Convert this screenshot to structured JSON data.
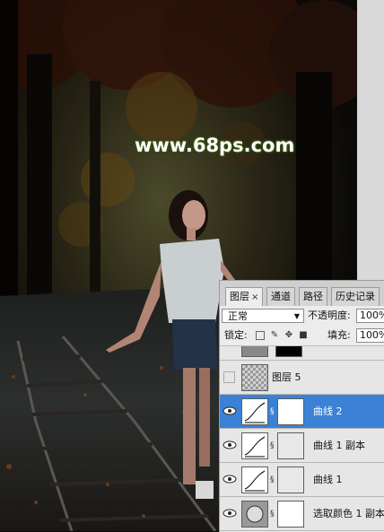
{
  "watermark": "www.68ps.com",
  "panel": {
    "tabs": [
      {
        "label": "图层",
        "close": "×"
      },
      {
        "label": "通道"
      },
      {
        "label": "路径"
      },
      {
        "label": "历史记录"
      }
    ],
    "blend_mode": "正常",
    "opacity_label": "不透明度:",
    "opacity_value": "100%",
    "lock_label": "锁定:",
    "fill_label": "填充:",
    "fill_value": "100%",
    "layers": [
      {
        "name": "图层 5",
        "visible": false,
        "selected": false
      },
      {
        "name": "曲线 2",
        "visible": true,
        "selected": true
      },
      {
        "name": "曲线 1 副本",
        "visible": true,
        "selected": false
      },
      {
        "name": "曲线 1",
        "visible": true,
        "selected": false
      },
      {
        "name": "选取颜色 1 副本",
        "visible": true,
        "selected": false
      }
    ]
  },
  "colors": {
    "panel_bg": "#e4e4e4",
    "selected_row": "#3b82d6",
    "watermark_glow": "#3e5a1a"
  }
}
